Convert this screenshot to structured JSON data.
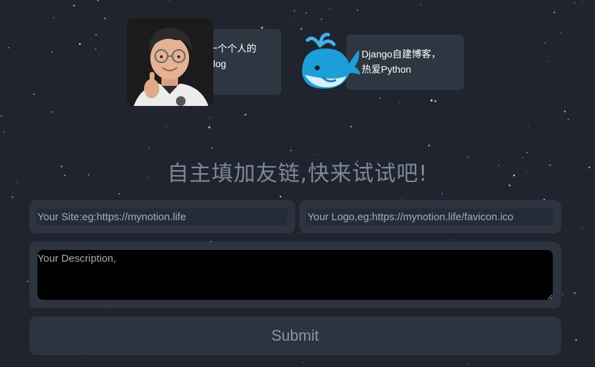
{
  "friends": [
    {
      "description": "一个个人的\nblog",
      "avatar": "memoji-avatar"
    },
    {
      "description": "Django自建博客，\n热爱Python",
      "avatar": "whale-emoji-avatar"
    }
  ],
  "form": {
    "heading": "自主填加友链,快来试试吧!",
    "site_placeholder": "Your Site:eg:https://mynotion.life",
    "logo_placeholder": "Your Logo,eg:https://mynotion.life/favicon.ico",
    "description_placeholder": "Your Description,",
    "submit_label": "Submit"
  },
  "colors": {
    "background": "#1f242e",
    "card": "#2e3642",
    "field": "#2d3440",
    "heading": "#7e8897"
  }
}
